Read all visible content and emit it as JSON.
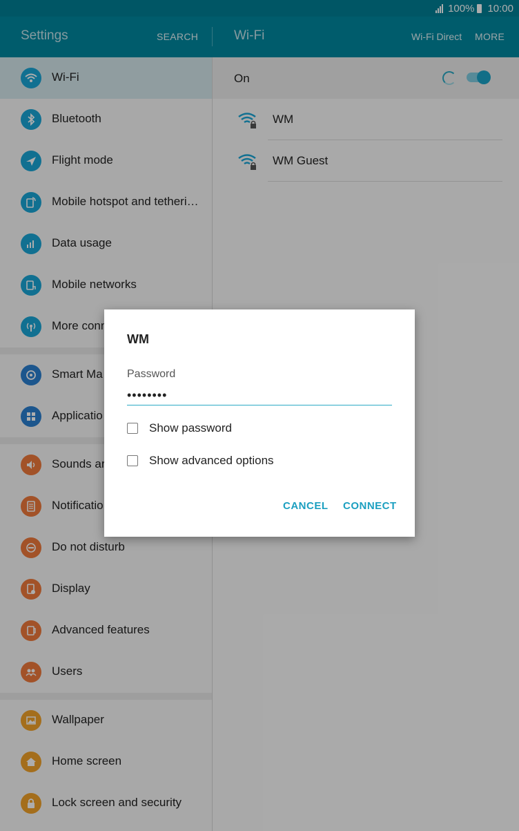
{
  "status_bar": {
    "battery": "100%",
    "time": "10:00"
  },
  "app_bar": {
    "left_title": "Settings",
    "search_label": "SEARCH",
    "right_title": "Wi-Fi",
    "wifi_direct_label": "Wi-Fi Direct",
    "more_label": "MORE"
  },
  "sidebar": {
    "items": [
      {
        "label": "Wi-Fi",
        "icon": "wifi-icon",
        "color": "#1aa6d6"
      },
      {
        "label": "Bluetooth",
        "icon": "bluetooth-icon",
        "color": "#1aa6d6"
      },
      {
        "label": "Flight mode",
        "icon": "airplane-icon",
        "color": "#1aa6d6"
      },
      {
        "label": "Mobile hotspot and tetheri…",
        "icon": "hotspot-icon",
        "color": "#1aa6d6"
      },
      {
        "label": "Data usage",
        "icon": "data-usage-icon",
        "color": "#1aa6d6"
      },
      {
        "label": "Mobile networks",
        "icon": "mobile-networks-icon",
        "color": "#1aa6d6"
      },
      {
        "label": "More conn",
        "icon": "more-connection-icon",
        "color": "#1aa6d6"
      },
      {
        "label": "Smart Ma",
        "icon": "smart-manager-icon",
        "color": "#2a7fd0"
      },
      {
        "label": "Applicatio",
        "icon": "applications-icon",
        "color": "#2a7fd0"
      },
      {
        "label": "Sounds ar",
        "icon": "sound-icon",
        "color": "#ef7a3b"
      },
      {
        "label": "Notificatio",
        "icon": "notifications-icon",
        "color": "#ef7a3b"
      },
      {
        "label": "Do not disturb",
        "icon": "do-not-disturb-icon",
        "color": "#ef7a3b"
      },
      {
        "label": "Display",
        "icon": "display-icon",
        "color": "#ef7a3b"
      },
      {
        "label": "Advanced features",
        "icon": "advanced-features-icon",
        "color": "#ef7a3b"
      },
      {
        "label": "Users",
        "icon": "users-icon",
        "color": "#ef7a3b"
      },
      {
        "label": "Wallpaper",
        "icon": "wallpaper-icon",
        "color": "#f2a22a"
      },
      {
        "label": "Home screen",
        "icon": "home-icon",
        "color": "#f2a22a"
      },
      {
        "label": "Lock screen and security",
        "icon": "lock-icon",
        "color": "#f2a22a"
      }
    ]
  },
  "wifi_panel": {
    "on_label": "On",
    "networks": [
      {
        "name": "WM",
        "icon": "wifi-locked-icon"
      },
      {
        "name": "WM Guest",
        "icon": "wifi-locked-icon"
      }
    ]
  },
  "dialog": {
    "title": "WM",
    "password_label": "Password",
    "password_value": "••••••••",
    "show_password_label": "Show password",
    "show_advanced_label": "Show advanced options",
    "cancel_label": "CANCEL",
    "connect_label": "CONNECT"
  },
  "colors": {
    "accent": "#1b9fc0",
    "app_bar": "#0088a0",
    "status_bar": "#007f96"
  }
}
